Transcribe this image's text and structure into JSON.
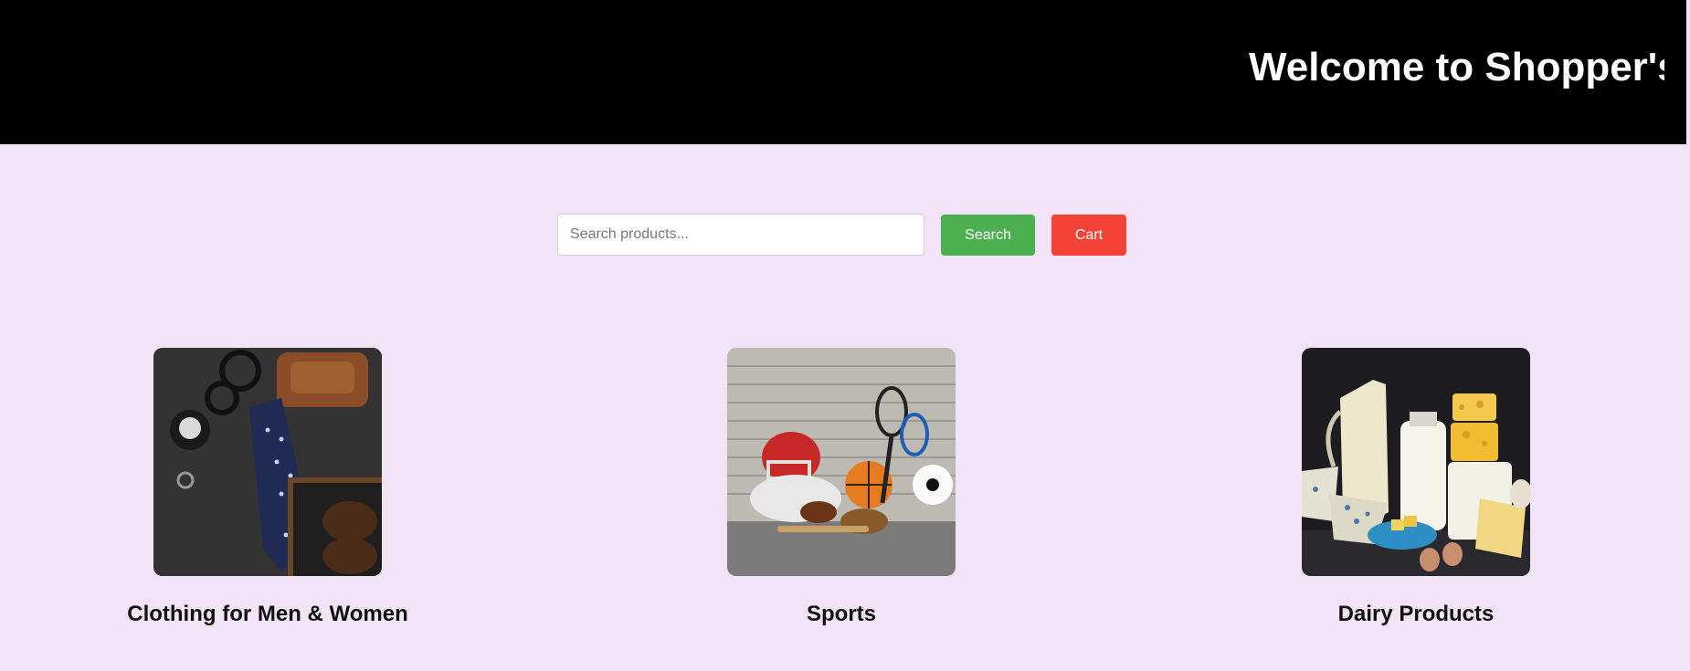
{
  "header": {
    "title": "Welcome to Shopper's S"
  },
  "search": {
    "placeholder": "Search products...",
    "value": "",
    "search_label": "Search",
    "cart_label": "Cart"
  },
  "categories": [
    {
      "label": "Clothing for Men & Women",
      "image_icon": "clothing-accessories-image"
    },
    {
      "label": "Sports",
      "image_icon": "sports-equipment-image"
    },
    {
      "label": "Dairy Products",
      "image_icon": "dairy-products-image"
    }
  ],
  "colors": {
    "page_background": "#f2e4f6",
    "header_background": "#000000",
    "search_button": "#4caf50",
    "cart_button": "#f44336"
  }
}
